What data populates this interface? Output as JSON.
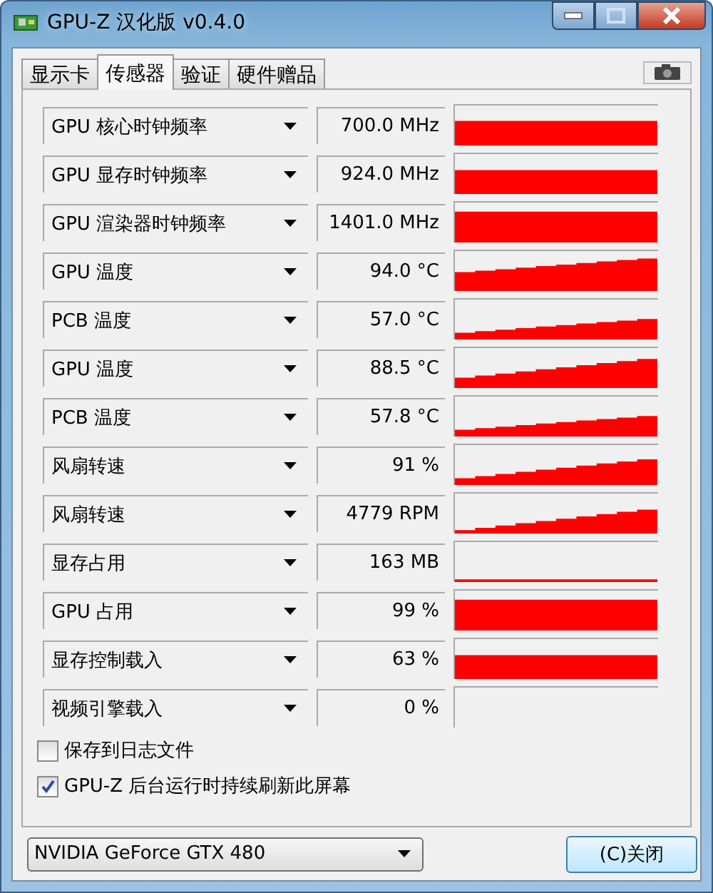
{
  "window": {
    "title": "GPU-Z 汉化版 v0.4.0"
  },
  "tabs": [
    {
      "label": "显示卡",
      "selected": false
    },
    {
      "label": "传感器",
      "selected": true
    },
    {
      "label": "验证",
      "selected": false
    },
    {
      "label": "硬件赠品",
      "selected": false
    }
  ],
  "sensors": [
    {
      "name": "GPU 核心时钟频率",
      "reading": "700.0 MHz"
    },
    {
      "name": "GPU 显存时钟频率",
      "reading": "924.0 MHz"
    },
    {
      "name": "GPU 渲染器时钟频率",
      "reading": "1401.0 MHz"
    },
    {
      "name": "GPU 温度",
      "reading": "94.0 °C"
    },
    {
      "name": "PCB 温度",
      "reading": "57.0 °C"
    },
    {
      "name": "GPU 温度",
      "reading": "88.5 °C"
    },
    {
      "name": "PCB 温度",
      "reading": "57.8 °C"
    },
    {
      "name": "风扇转速",
      "reading": "91 %"
    },
    {
      "name": "风扇转速",
      "reading": "4779 RPM"
    },
    {
      "name": "显存占用",
      "reading": "163 MB"
    },
    {
      "name": "GPU 占用",
      "reading": "99 %"
    },
    {
      "name": "显存控制载入",
      "reading": "63 %"
    },
    {
      "name": "视频引擎载入",
      "reading": "0 %"
    }
  ],
  "options": [
    {
      "label": "保存到日志文件",
      "checked": false
    },
    {
      "label": "GPU-Z 后台运行时持续刷新此屏幕",
      "checked": true
    }
  ],
  "device": {
    "value": "NVIDIA GeForce GTX 480"
  },
  "close_button": "(C)关闭"
}
